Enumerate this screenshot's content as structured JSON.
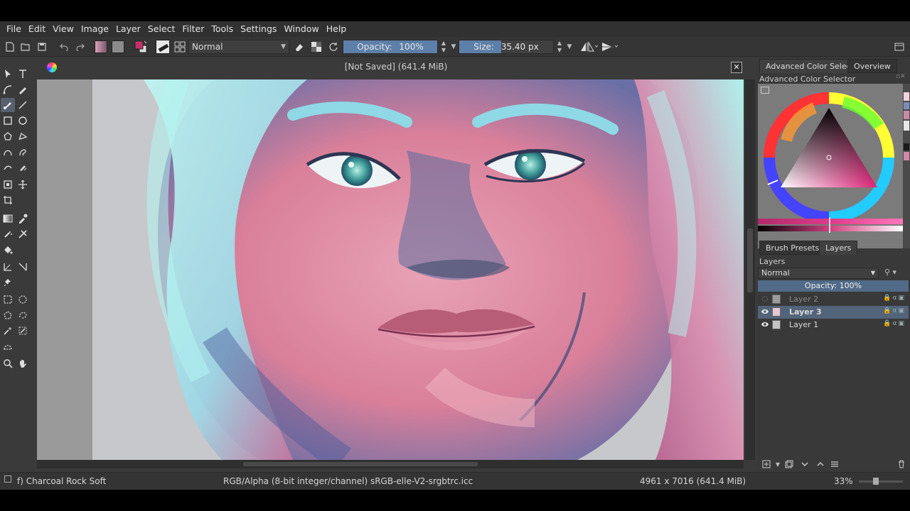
{
  "menubar": {
    "items": [
      "File",
      "Edit",
      "View",
      "Image",
      "Layer",
      "Select",
      "Filter",
      "Tools",
      "Settings",
      "Window",
      "Help"
    ]
  },
  "toolbar": {
    "blend_mode": "Normal",
    "opacity_label": "Opacity:",
    "opacity_value": "100%",
    "opacity_fraction": 1.0,
    "size_label": "Size:",
    "size_value": "35.40 px",
    "size_fraction": 0.45
  },
  "document": {
    "title": "[Not Saved]  (641.4 MiB)",
    "close_glyph": "✕"
  },
  "dock": {
    "top_tabs": [
      "Advanced Color Selector",
      "Overview"
    ],
    "color_panel_title": "Advanced Color Selector",
    "selected_color": "#c4306a",
    "swatches": [
      "#f2d4dc",
      "#7a8fb8",
      "#c98aa4",
      "#e8e8e8",
      "#1a1a1a",
      "#d08aa8"
    ],
    "bottom_tabs": [
      "Brush Presets",
      "Layers"
    ],
    "layers_title": "Layers",
    "layer_blend_mode": "Normal",
    "layer_opacity_label": "Opacity:  100%",
    "layers": [
      {
        "name": "Layer 2",
        "visible": false,
        "selected": false
      },
      {
        "name": "Layer 3",
        "visible": true,
        "selected": true
      },
      {
        "name": "Layer 1",
        "visible": true,
        "selected": false
      }
    ]
  },
  "statusbar": {
    "brush_name": "f) Charcoal Rock Soft",
    "color_profile": "RGB/Alpha (8-bit integer/channel)  sRGB-elle-V2-srgbtrc.icc",
    "image_size": "4961 x 7016 (641.4 MiB)",
    "zoom": "33%"
  }
}
